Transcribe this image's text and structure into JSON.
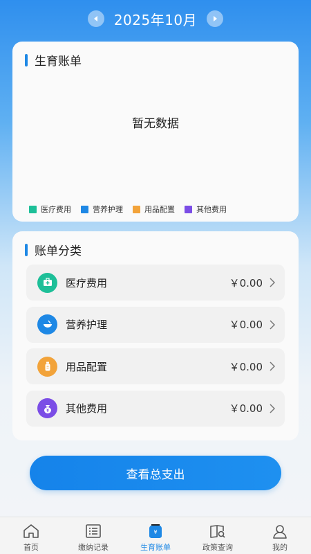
{
  "header": {
    "month": "2025年10月"
  },
  "bill_card": {
    "title": "生育账单",
    "empty_text": "暂无数据",
    "legend": [
      {
        "label": "医疗费用",
        "color": "#1dbf98"
      },
      {
        "label": "营养护理",
        "color": "#1e88e5"
      },
      {
        "label": "用品配置",
        "color": "#f2a33a"
      },
      {
        "label": "其他费用",
        "color": "#7b4de6"
      }
    ]
  },
  "category_card": {
    "title": "账单分类",
    "items": [
      {
        "label": "医疗费用",
        "amount": "￥0.00",
        "icon": "medical-kit-icon",
        "color": "#1dbf98"
      },
      {
        "label": "营养护理",
        "amount": "￥0.00",
        "icon": "bowl-icon",
        "color": "#1e88e5"
      },
      {
        "label": "用品配置",
        "amount": "￥0.00",
        "icon": "bottle-icon",
        "color": "#f2a33a"
      },
      {
        "label": "其他费用",
        "amount": "￥0.00",
        "icon": "money-bag-icon",
        "color": "#7b4de6"
      }
    ]
  },
  "total_button": {
    "label": "查看总支出"
  },
  "tabbar": {
    "items": [
      {
        "label": "首页",
        "icon": "home-icon"
      },
      {
        "label": "缴纳记录",
        "icon": "list-icon"
      },
      {
        "label": "生育账单",
        "icon": "bill-icon",
        "active": true
      },
      {
        "label": "政策查询",
        "icon": "book-search-icon"
      },
      {
        "label": "我的",
        "icon": "user-icon"
      }
    ]
  }
}
